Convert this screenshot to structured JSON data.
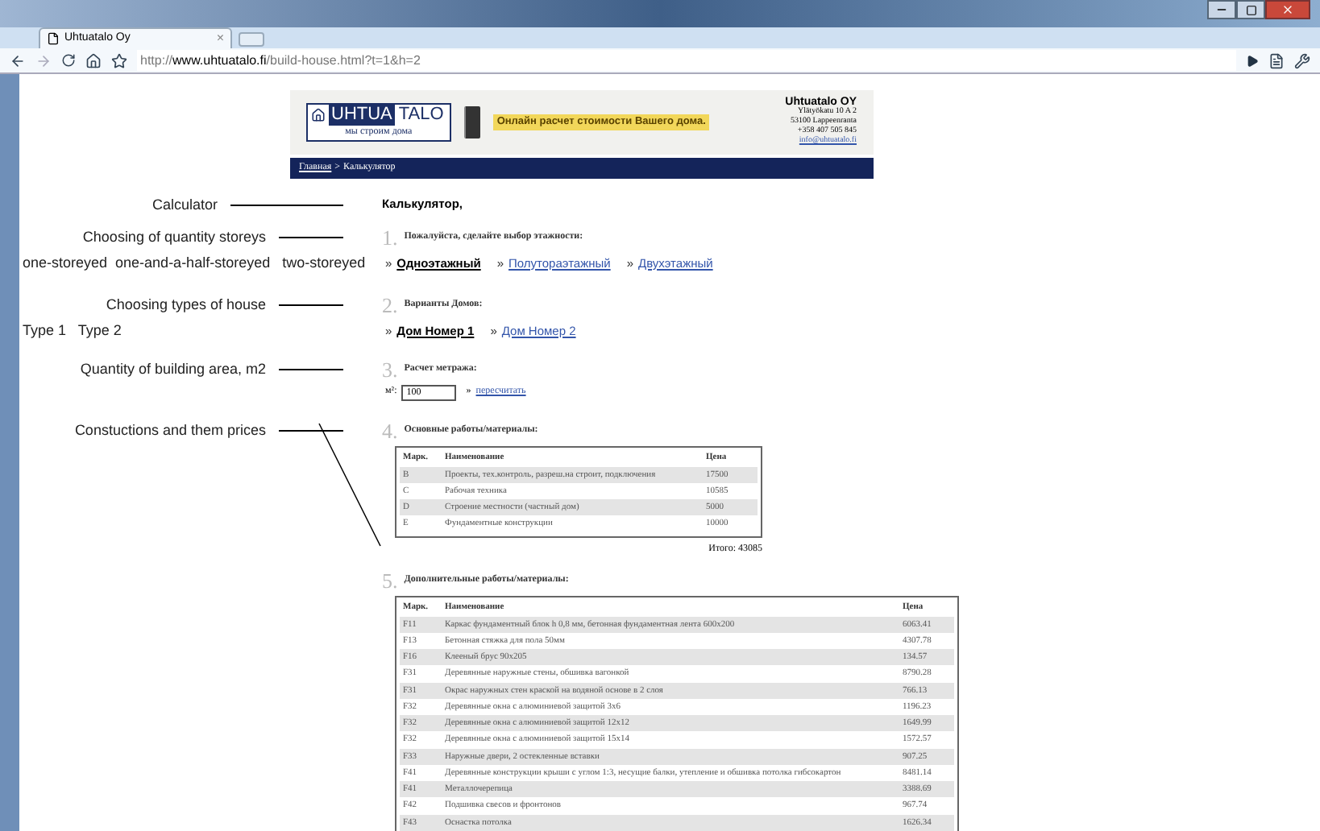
{
  "browser": {
    "tab_title": "Uhtuatalo Oy",
    "tab_close": "×",
    "url_scheme": "http://",
    "url_host": "www.uhtuatalo.fi",
    "url_path": "/build-house.html?t=1&h=2"
  },
  "header": {
    "logo_left": "UHTUA",
    "logo_right": "TALO",
    "tagline": "мы строим дома",
    "banner": "Онлайн расчет стоимости Вашего дома.",
    "company": "Uhtuatalo OY",
    "address": [
      "Ylätyökatu 10 A 2",
      "53100 Lappeenranta",
      "+358 407 505 845"
    ],
    "email": "info@uhtuatalo.fi"
  },
  "breadcrumb": {
    "link": "Главная",
    "separator": ">",
    "current": "Калькулятор"
  },
  "page_title": "Калькулятор,",
  "annotations": [
    {
      "label": "Calculator"
    },
    {
      "label": "Choosing of quantity storeys",
      "detail": "one-storeyed  one-and-a-half-storeyed   two-storeyed"
    },
    {
      "label": "Choosing types of house",
      "detail": "Type 1   Type 2"
    },
    {
      "label": "Quantity of building area, m2"
    },
    {
      "label": "Constuctions and them prices"
    }
  ],
  "steps": [
    {
      "number": "1.",
      "kind": "options",
      "title": "Пожалуйста, сделайте выбор этажности:",
      "options": [
        {
          "bullet": "»",
          "label": "Одноэтажный",
          "selected": true
        },
        {
          "bullet": "»",
          "label": "Полутораэтажный",
          "selected": false
        },
        {
          "bullet": "»",
          "label": "Двухэтажный",
          "selected": false
        }
      ]
    },
    {
      "number": "2.",
      "kind": "options",
      "title": "Варианты Домов:",
      "options": [
        {
          "bullet": "»",
          "label": "Дом Номер 1",
          "selected": true
        },
        {
          "bullet": "»",
          "label": "Дом Номер 2",
          "selected": false
        }
      ]
    },
    {
      "number": "3.",
      "kind": "area",
      "title": "Расчет метража:",
      "unit": "м²:",
      "value": "100",
      "bullet": "»",
      "action": "пересчитать"
    },
    {
      "number": "4.",
      "kind": "table",
      "title": "Основные работы/материалы:",
      "columns": [
        "Марк.",
        "Наименование",
        "Цена"
      ],
      "rows": [
        [
          "B",
          "Проекты, тех.контроль, разреш.на строит, подключения",
          "17500"
        ],
        [
          "C",
          "Рабочая техника",
          "10585"
        ],
        [
          "D",
          "Строение местности (частный дом)",
          "5000"
        ],
        [
          "E",
          "Фундаментные конструкции",
          "10000"
        ]
      ],
      "total": "Итого: 43085"
    },
    {
      "number": "5.",
      "kind": "table",
      "title": "Дополнительные работы/материалы:",
      "columns": [
        "Марк.",
        "Наименование",
        "Цена"
      ],
      "rows": [
        [
          "F11",
          "Каркас фундаментный блок h 0,8 мм, бетонная фундаментная лента 600x200",
          "6063.41"
        ],
        [
          "F13",
          "Бетонная стяжка для пола 50мм",
          "4307.78"
        ],
        [
          "F16",
          "Клееный брус 90x205",
          "134.57"
        ],
        [
          "F31",
          "Деревянные наружные стены, обшивка вагонкой",
          "8790.28"
        ],
        [
          "F31",
          "Окрас наружных стен краской на водяной основе в 2 слоя",
          "766.13"
        ],
        [
          "F32",
          "Деревянные окна с алюминиевой защитой 3x6",
          "1196.23"
        ],
        [
          "F32",
          "Деревянные окна с алюминиевой защитой 12x12",
          "1649.99"
        ],
        [
          "F32",
          "Деревянные окна с алюминиевой защитой 15x14",
          "1572.57"
        ],
        [
          "F33",
          "Наружные двери, 2 остекленные вставки",
          "907.25"
        ],
        [
          "F41",
          "Деревянные конструкции крыши с углом 1:3, несущие балки, утепление и обшивка потолка гибсокартон",
          "8481.14"
        ],
        [
          "F41",
          "Металлочерепица",
          "3388.69"
        ],
        [
          "F42",
          "Подшивка свесов и фронтонов",
          "967.74"
        ],
        [
          "F43",
          "Оснастка потолка",
          "1626.34"
        ]
      ]
    }
  ]
}
